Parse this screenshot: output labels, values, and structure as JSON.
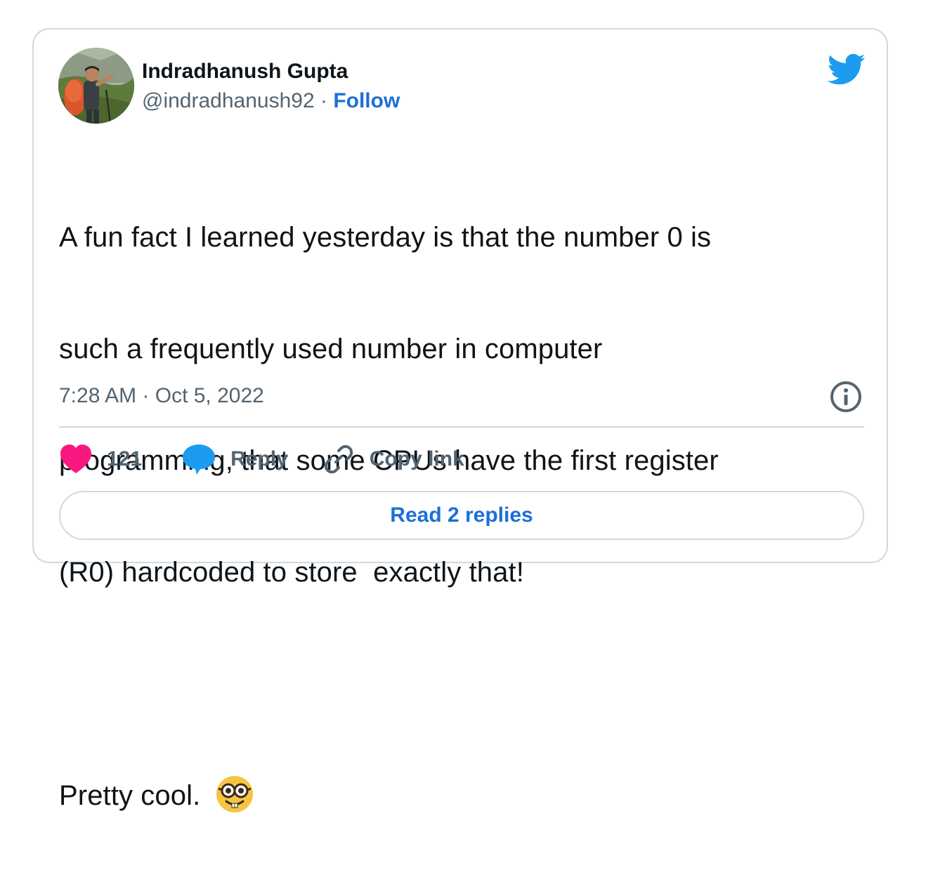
{
  "author": {
    "display_name": "Indradhanush Gupta",
    "handle": "@indradhanush92",
    "separator": " · ",
    "follow_label": "Follow",
    "avatar_icon": "profile-photo"
  },
  "brand": {
    "icon": "twitter-bird-icon",
    "color": "#1d9bf0"
  },
  "tweet": {
    "lines": [
      "A fun fact I learned yesterday is that the number 0 is",
      "such a frequently used number in computer",
      "programming, that some CPUs have the first register",
      "(R0) hardcoded to store  exactly that!",
      "",
      "Pretty cool."
    ],
    "emoji": "nerd-face-emoji",
    "timestamp": "7:28 AM · Oct 5, 2022"
  },
  "actions": {
    "like_count": "121",
    "like_color": "#f91880",
    "reply_label": "Reply",
    "reply_color": "#1d9bf0",
    "copy_label": "Copy link",
    "read_replies_label": "Read 2 replies"
  },
  "colors": {
    "link": "#1d6fd6",
    "secondary_text": "#536471",
    "border": "#cfd9de"
  }
}
